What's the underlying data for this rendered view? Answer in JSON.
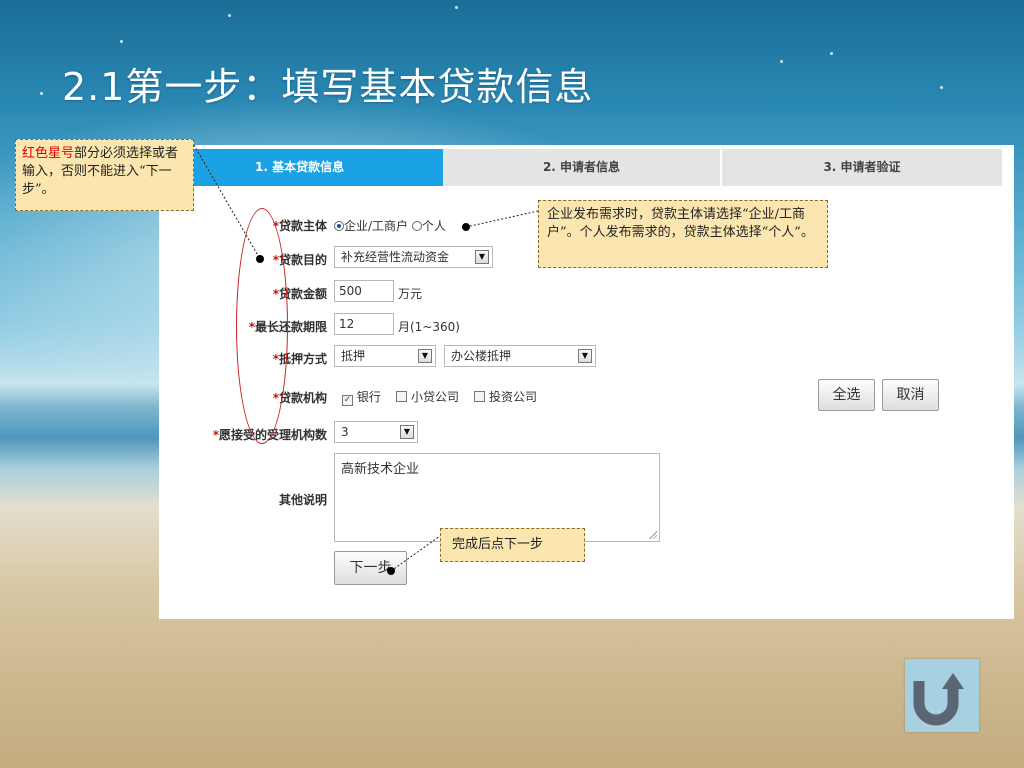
{
  "slide_title": "2.1第一步：填写基本贷款信息",
  "tabs": [
    {
      "label": "1. 基本贷款信息",
      "active": true
    },
    {
      "label": "2. 申请者信息",
      "active": false
    },
    {
      "label": "3. 申请者验证",
      "active": false
    }
  ],
  "required_mark": "*",
  "form": {
    "subject_label": "贷款主体",
    "subject_options": [
      "企业/工商户",
      "个人"
    ],
    "subject_selected": "企业/工商户",
    "purpose_label": "贷款目的",
    "purpose_value": "补充经营性流动资金",
    "amount_label": "贷款金额",
    "amount_value": "500",
    "amount_unit": "万元",
    "term_label": "最长还款期限",
    "term_value": "12",
    "term_unit": "月(1~360)",
    "collateral_label": "抵押方式",
    "collateral_value": "抵押",
    "collateral_detail": "办公楼抵押",
    "institution_label": "贷款机构",
    "institutions": [
      {
        "label": "银行",
        "checked": true
      },
      {
        "label": "小贷公司",
        "checked": false
      },
      {
        "label": "投资公司",
        "checked": false
      }
    ],
    "select_all": "全选",
    "cancel": "取消",
    "accept_count_label": "愿接受的受理机构数",
    "accept_count_value": "3",
    "remark_label": "其他说明",
    "remark_value": "高新技术企业",
    "next_button": "下一步"
  },
  "notes": {
    "required_red": "红色星号",
    "required_rest": "部分必须选择或者输入，否则不能进入“下一步”。",
    "subject_note": "企业发布需求时，贷款主体请选择“企业/工商户”。个人发布需求的，贷款主体选择“个人”。",
    "next_note": "完成后点下一步"
  },
  "icons": {
    "back": "u-turn-arrow-icon"
  },
  "colors": {
    "active_tab": "#1aa2e4",
    "required": "#d01010",
    "note_bg": "#fbe6b0"
  }
}
